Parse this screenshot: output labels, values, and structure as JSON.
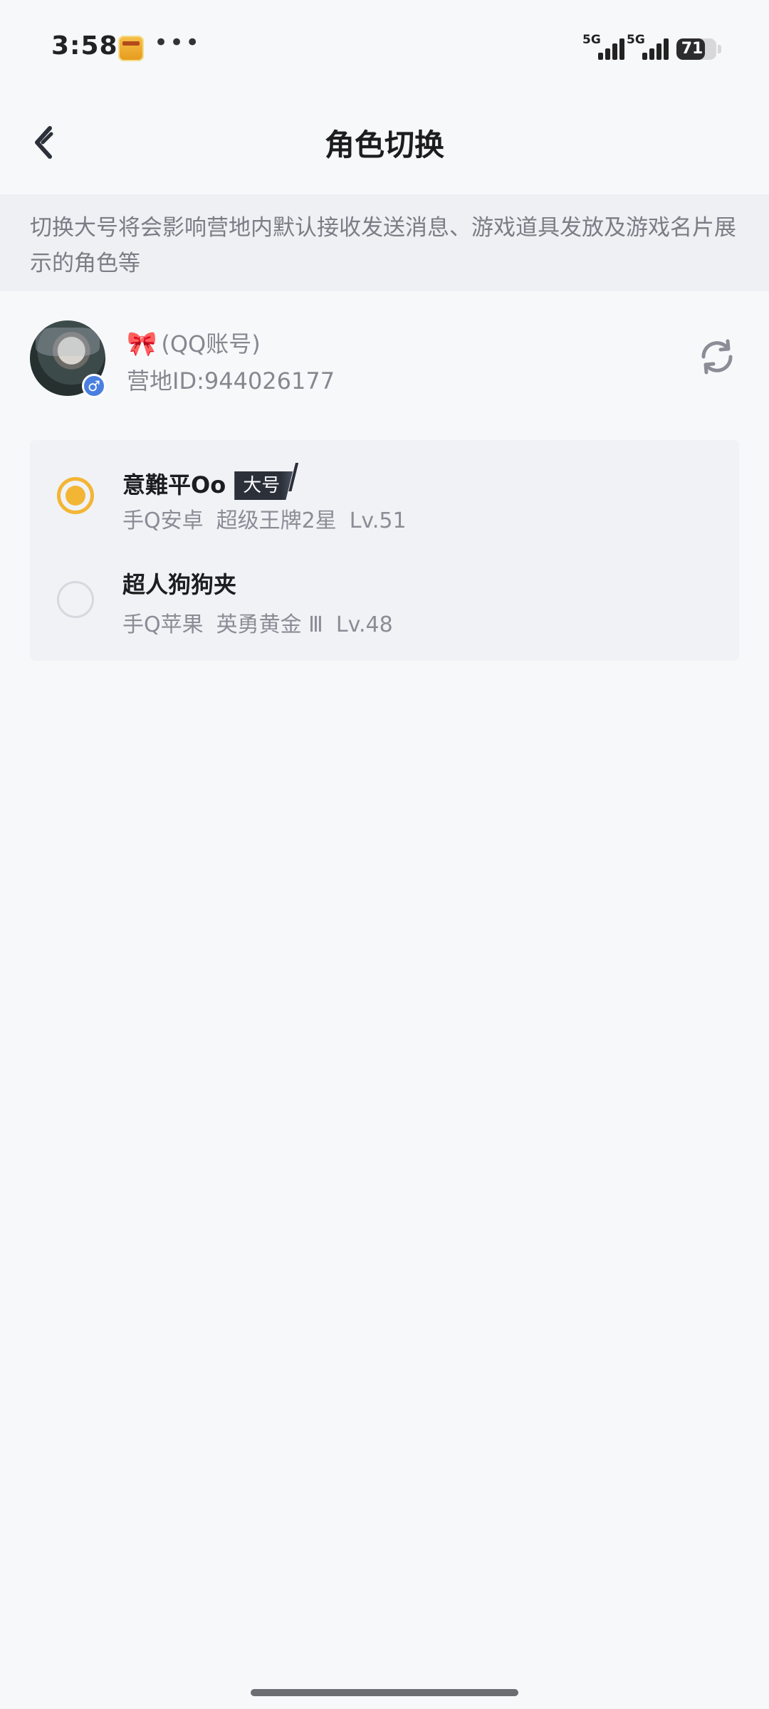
{
  "status_bar": {
    "time": "3:58",
    "more": "•••",
    "signal_1_label": "5G",
    "signal_2_label": "5G",
    "battery": "71",
    "battery_level": 71
  },
  "nav": {
    "title": "角色切换"
  },
  "notice": {
    "text": "切换大号将会影响营地内默认接收发送消息、游戏道具发放及游戏名片展示的角色等"
  },
  "account": {
    "name_icon": "🎀",
    "name": "(QQ账号)",
    "gender_icon": "♂",
    "camp_id": "营地ID:944026177"
  },
  "roles": [
    {
      "name": "意難平Oo",
      "tag": "大号",
      "selected": true,
      "platform": "手Q安卓",
      "rank": "超级王牌2星",
      "level": "Lv.51"
    },
    {
      "name": "超人狗狗夹",
      "tag": "",
      "selected": false,
      "platform": "手Q苹果",
      "rank": "英勇黄金 Ⅲ",
      "level": "Lv.48"
    }
  ],
  "colors": {
    "accent": "#f3b534",
    "tag_bg": "#2b3039",
    "background": "#f7f8fa"
  }
}
